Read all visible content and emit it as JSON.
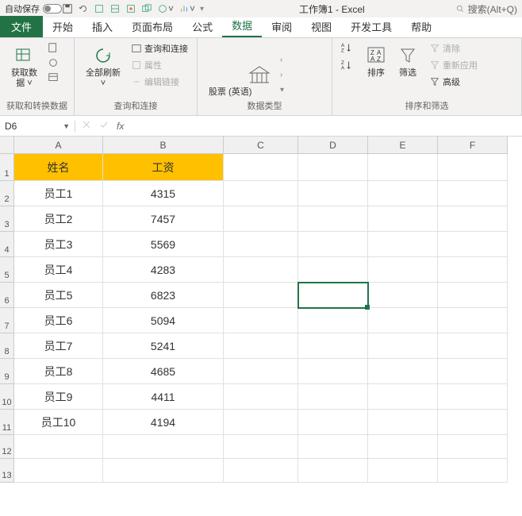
{
  "titlebar": {
    "autosave_label": "自动保存",
    "doc_title": "工作簿1 - Excel",
    "search_placeholder": "搜索(Alt+Q)"
  },
  "tabs": {
    "file": "文件",
    "home": "开始",
    "insert": "插入",
    "page_layout": "页面布局",
    "formulas": "公式",
    "data": "数据",
    "review": "审阅",
    "view": "视图",
    "developer": "开发工具",
    "help": "帮助"
  },
  "ribbon": {
    "group1": {
      "get_data": "获取数\n据 ˅",
      "label": "获取和转换数据"
    },
    "group2": {
      "refresh_all": "全部刷新\n˅",
      "queries": "查询和连接",
      "properties": "属性",
      "edit_links": "编辑链接",
      "label": "查询和连接"
    },
    "group3": {
      "stocks": "股票 (英语)",
      "label": "数据类型"
    },
    "group4": {
      "sort": "排序",
      "filter": "筛选",
      "clear": "清除",
      "reapply": "重新应用",
      "advanced": "高级",
      "label": "排序和筛选"
    }
  },
  "name_box": "D6",
  "fx_label": "fx",
  "columns": [
    "A",
    "B",
    "C",
    "D",
    "E",
    "F"
  ],
  "rows": [
    1,
    2,
    3,
    4,
    5,
    6,
    7,
    8,
    9,
    10,
    11,
    12,
    13
  ],
  "table": {
    "headers": [
      "姓名",
      "工资"
    ],
    "data": [
      [
        "员工1",
        "4315"
      ],
      [
        "员工2",
        "7457"
      ],
      [
        "员工3",
        "5569"
      ],
      [
        "员工4",
        "4283"
      ],
      [
        "员工5",
        "6823"
      ],
      [
        "员工6",
        "5094"
      ],
      [
        "员工7",
        "5241"
      ],
      [
        "员工8",
        "4685"
      ],
      [
        "员工9",
        "4411"
      ],
      [
        "员工10",
        "4194"
      ]
    ]
  },
  "selected_cell": {
    "row": 6,
    "col": "D"
  },
  "chart_data": {
    "type": "table",
    "title": "",
    "columns": [
      "姓名",
      "工资"
    ],
    "rows": [
      {
        "姓名": "员工1",
        "工资": 4315
      },
      {
        "姓名": "员工2",
        "工资": 7457
      },
      {
        "姓名": "员工3",
        "工资": 5569
      },
      {
        "姓名": "员工4",
        "工资": 4283
      },
      {
        "姓名": "员工5",
        "工资": 6823
      },
      {
        "姓名": "员工6",
        "工资": 5094
      },
      {
        "姓名": "员工7",
        "工资": 5241
      },
      {
        "姓名": "员工8",
        "工资": 4685
      },
      {
        "姓名": "员工9",
        "工资": 4411
      },
      {
        "姓名": "员工10",
        "工资": 4194
      }
    ]
  }
}
